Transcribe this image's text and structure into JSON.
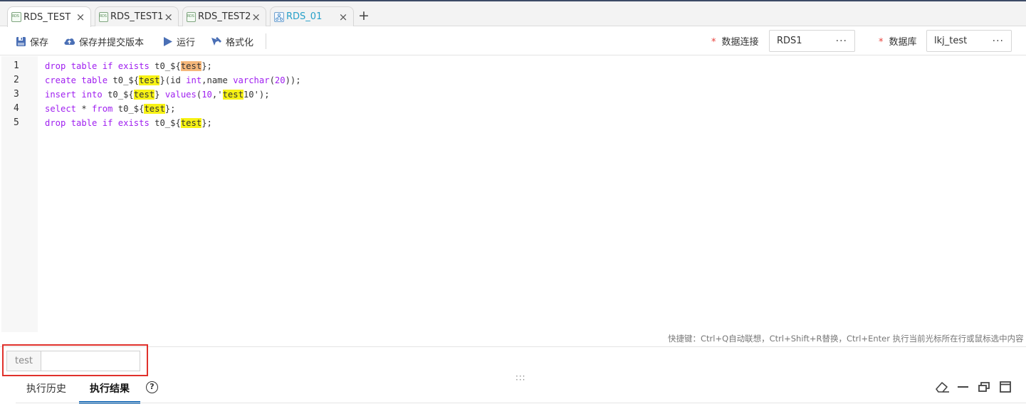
{
  "tabs": [
    {
      "label": "RDS_TEST",
      "active": true,
      "icon": "rds-file-icon"
    },
    {
      "label": "RDS_TEST1",
      "active": false,
      "icon": "rds-file-icon"
    },
    {
      "label": "RDS_TEST2",
      "active": false,
      "icon": "rds-file-icon"
    },
    {
      "label": "RDS_01",
      "active": false,
      "icon": "workflow-icon"
    }
  ],
  "tab_close_glyph": "×",
  "add_tab_glyph": "+",
  "toolbar": {
    "save_label": "保存",
    "save_submit_label": "保存并提交版本",
    "run_label": "运行",
    "format_label": "格式化"
  },
  "connection": {
    "label": "数据连接",
    "required_mark": "*",
    "value": "RDS1",
    "more": "···"
  },
  "database": {
    "label": "数据库",
    "required_mark": "*",
    "value": "lkj_test",
    "more": "···"
  },
  "editor": {
    "line_numbers": [
      "1",
      "2",
      "3",
      "4",
      "5"
    ],
    "lines": [
      "drop table if exists t0_${test};",
      "create table t0_${test}(id int,name varchar(20));",
      "insert into t0_${test} values(10,'test10');",
      "select * from t0_${test};",
      "drop table if exists t0_${test};"
    ]
  },
  "shortcut_hint": "快捷键：Ctrl+Q自动联想，Ctrl+Shift+R替换，Ctrl+Enter 执行当前光标所在行或鼠标选中内容",
  "parameter": {
    "name": "test",
    "value": ""
  },
  "bottom_tabs": [
    {
      "label": "执行历史",
      "active": false
    },
    {
      "label": "执行结果",
      "active": true
    }
  ],
  "help_glyph": "?",
  "drag_handle_glyph": "⋮⋮⋮",
  "colors": {
    "keyword": "#a020f0",
    "variable_highlight": "#f7f214",
    "selected_highlight": "#f5b77a",
    "required": "#e8413c",
    "active_tab_underline": "#1f6fb8",
    "param_box_border": "#e0312b"
  }
}
